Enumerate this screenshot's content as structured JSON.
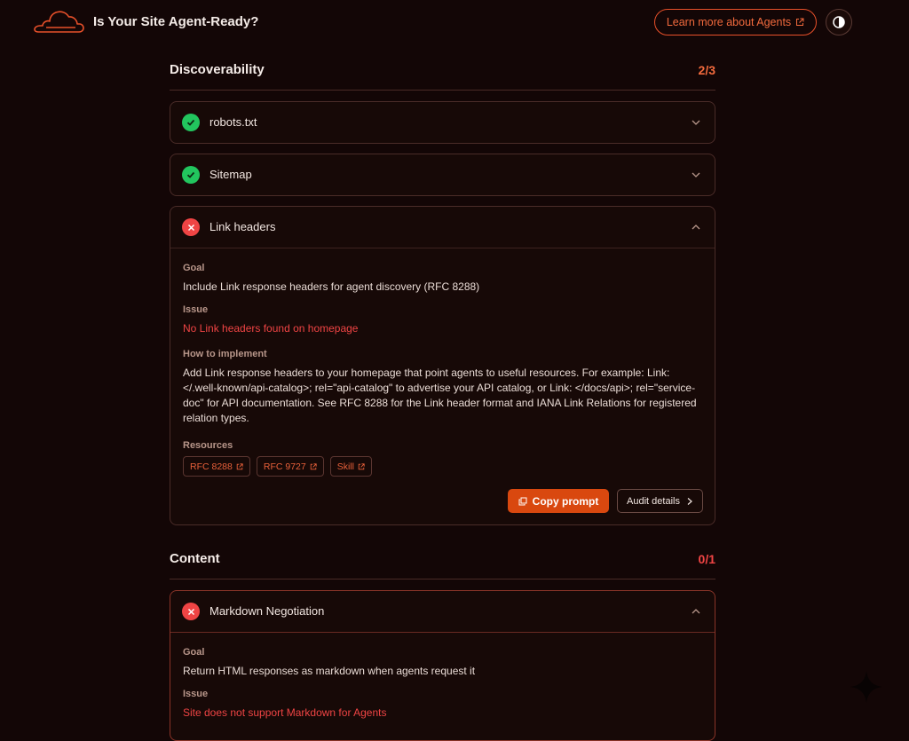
{
  "header": {
    "title": "Is Your Site Agent-Ready?",
    "learn_more_label": "Learn more about Agents"
  },
  "sections": [
    {
      "title": "Discoverability",
      "score": "2/3",
      "score_color": "#f26a3d",
      "checks": [
        {
          "title": "robots.txt",
          "status": "pass"
        },
        {
          "title": "Sitemap",
          "status": "pass"
        },
        {
          "title": "Link headers",
          "status": "fail",
          "goal_label": "Goal",
          "goal": "Include Link response headers for agent discovery (RFC 8288)",
          "issue_label": "Issue",
          "issue": "No Link headers found on homepage",
          "how_label": "How to implement",
          "how": "Add Link response headers to your homepage that point agents to useful resources. For example: Link: </.well-known/api-catalog>; rel=\"api-catalog\" to advertise your API catalog, or Link: </docs/api>; rel=\"service-doc\" for API documentation. See RFC 8288 for the Link header format and IANA Link Relations for registered relation types.",
          "resources_label": "Resources",
          "resources": [
            "RFC 8288",
            "RFC 9727",
            "Skill"
          ],
          "copy_prompt_label": "Copy prompt",
          "audit_details_label": "Audit details"
        }
      ]
    },
    {
      "title": "Content",
      "score": "0/1",
      "score_color": "#ef4444",
      "checks": [
        {
          "title": "Markdown Negotiation",
          "status": "fail",
          "goal_label": "Goal",
          "goal": "Return HTML responses as markdown when agents request it",
          "issue_label": "Issue",
          "issue": "Site does not support Markdown for Agents"
        }
      ]
    }
  ],
  "colors": {
    "accent": "#e8502a",
    "pass": "#22c55e",
    "fail": "#ef4444",
    "background": "#130606"
  }
}
